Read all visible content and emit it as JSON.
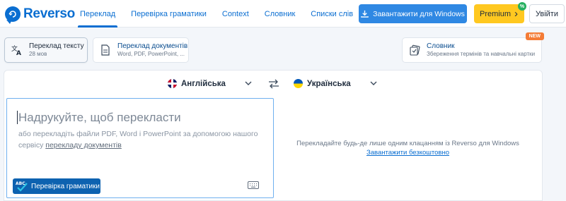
{
  "brand": {
    "name": "Reverso",
    "accent": "#0a6ed1"
  },
  "nav": {
    "items": [
      {
        "label": "Переклад",
        "active": true
      },
      {
        "label": "Перевірка граматики",
        "active": false
      },
      {
        "label": "Context",
        "active": false
      },
      {
        "label": "Словник",
        "active": false
      },
      {
        "label": "Списки слів",
        "active": false
      }
    ],
    "more": "•••",
    "download_label": "Завантажити для Windows",
    "premium_label": "Premium",
    "premium_chevron": "›",
    "login_label": "Увійти"
  },
  "modes": {
    "text": {
      "title": "Переклад тексту",
      "subtitle": "28 мов"
    },
    "docs": {
      "title": "Переклад документів",
      "subtitle": "Word, PDF, PowerPoint, ..."
    },
    "dictionary": {
      "title": "Словник",
      "subtitle": "Збереження термінів та навчальні картки",
      "badge": "NEW"
    }
  },
  "translator": {
    "source_lang": "Англійська",
    "target_lang": "Українська",
    "placeholder": "Надрукуйте, щоб перекласти",
    "hint_prefix": "або перекладіть файли PDF, Word і PowerPoint за допомогою нашого сервісу ",
    "hint_link": "перекладу документів",
    "grammar_button": "Перевірка граматики",
    "grammar_badge": "ABC",
    "target_note": "Перекладайте будь-де лише одним клацанням із Reverso для Windows",
    "target_link": "Завантажити безкоштовно"
  }
}
